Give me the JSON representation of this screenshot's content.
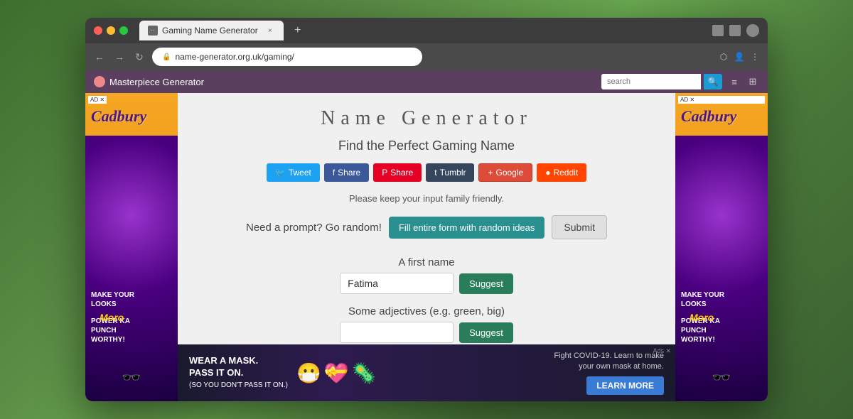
{
  "browser": {
    "tab_title": "Gaming Name Generator",
    "url": "name-generator.org.uk/gaming/",
    "new_tab_icon": "+",
    "back_icon": "←",
    "forward_icon": "→",
    "refresh_icon": "↻"
  },
  "toolbar": {
    "logo_text": "Masterpiece Generator",
    "search_placeholder": "search"
  },
  "page": {
    "title": "Name Generator",
    "subtitle": "Find the Perfect Gaming Name",
    "family_friendly": "Please keep your input family friendly.",
    "random_prompt": "Need a prompt? Go random!",
    "fill_random_btn": "Fill entire form with random ideas",
    "submit_btn": "Submit",
    "first_name_label": "A first name",
    "first_name_value": "Fatima",
    "first_name_placeholder": "",
    "suggest_btn_1": "Suggest",
    "adjectives_label": "Some adjectives (e.g. green, big)",
    "adjectives_value": "",
    "adjectives_placeholder": "",
    "suggest_btn_2": "Suggest"
  },
  "social": {
    "tweet": "Tweet",
    "share_fb": "Share",
    "share_pin": "Share",
    "tumblr": "Tumblr",
    "google": "Google",
    "reddit": "Reddit"
  },
  "bottom_ad": {
    "text_line1": "WEAR A MASK.",
    "text_line2": "PASS IT ON.",
    "text_line3": "(SO YOU DON'T PASS IT ON.)",
    "info": "Fight COVID-19. Learn to make\nyour own mask at home.",
    "learn_more": "LEARN MORE",
    "ads_label": "Ads ✕"
  },
  "cadbury_left": "Cadbury",
  "cadbury_right": "Cadbury",
  "ad_text_make": "MAKE YOUR\nLOOKS",
  "ad_text_punch": "POWER KA\nPUNCH\nWORTHY!",
  "ad_badge": "AD"
}
